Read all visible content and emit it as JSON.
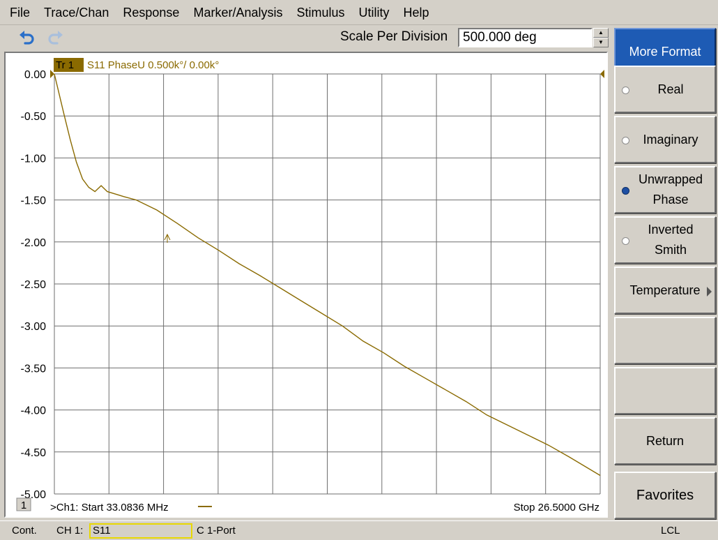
{
  "menubar": {
    "items": [
      "File",
      "Trace/Chan",
      "Response",
      "Marker/Analysis",
      "Stimulus",
      "Utility",
      "Help"
    ]
  },
  "toolbar": {
    "undo_icon": "undo-arrow-icon",
    "redo_icon": "redo-arrow-icon",
    "entry_label": "Scale Per Division",
    "entry_value": "500.000 deg"
  },
  "trace": {
    "tag": "Tr  1",
    "header": "S11 PhaseU 0.500k°/  0.00k°",
    "color": "#8a6a00"
  },
  "footer": {
    "channel_number": "1",
    "start_text": ">Ch1:   Start  33.0836 MHz",
    "stop_text": "Stop  26.5000 GHz"
  },
  "softkeys": {
    "title": "More Format",
    "items": [
      {
        "label": "Real",
        "radio": "off"
      },
      {
        "label": "Imaginary",
        "radio": "off"
      },
      {
        "label": "Unwrapped Phase",
        "radio": "on"
      },
      {
        "label": "Inverted Smith",
        "radio": "off"
      },
      {
        "label": "Temperature",
        "submenu": true
      },
      {
        "label": ""
      },
      {
        "label": ""
      },
      {
        "label": "Return"
      },
      {
        "label": "Favorites"
      }
    ]
  },
  "statusbar": {
    "mode": "Cont.",
    "channel": "CH 1:",
    "measurement": "S11",
    "correction": "C  1-Port",
    "remote": "LCL"
  },
  "chart_data": {
    "type": "line",
    "ylim": [
      -5.0,
      0.0
    ],
    "y_ticks": [
      "0.00",
      "-0.50",
      "-1.00",
      "-1.50",
      "-2.00",
      "-2.50",
      "-3.00",
      "-3.50",
      "-4.00",
      "-4.50",
      "-5.00"
    ],
    "grid": true,
    "x_divisions": 10,
    "xlim_ghz": [
      0.0330836,
      26.5
    ],
    "series": [
      {
        "color": "#8a6a00",
        "x": [
          0.0331,
          0.5,
          0.8,
          1.1,
          1.4,
          1.7,
          2.0,
          2.3,
          2.6,
          3.0,
          3.4,
          4.0,
          5.0,
          6.0,
          7.0,
          8.0,
          9.0,
          10.0,
          11.0,
          12.0,
          13.0,
          14.0,
          15.0,
          16.0,
          17.0,
          18.0,
          19.0,
          20.0,
          21.0,
          22.0,
          23.0,
          24.0,
          25.0,
          26.5
        ],
        "y": [
          0.0,
          -0.48,
          -0.78,
          -1.05,
          -1.25,
          -1.35,
          -1.4,
          -1.33,
          -1.4,
          -1.43,
          -1.46,
          -1.5,
          -1.62,
          -1.78,
          -1.95,
          -2.1,
          -2.26,
          -2.4,
          -2.55,
          -2.7,
          -2.85,
          -3.0,
          -3.18,
          -3.32,
          -3.48,
          -3.62,
          -3.76,
          -3.9,
          -4.06,
          -4.18,
          -4.3,
          -4.42,
          -4.56,
          -4.78
        ]
      }
    ]
  }
}
